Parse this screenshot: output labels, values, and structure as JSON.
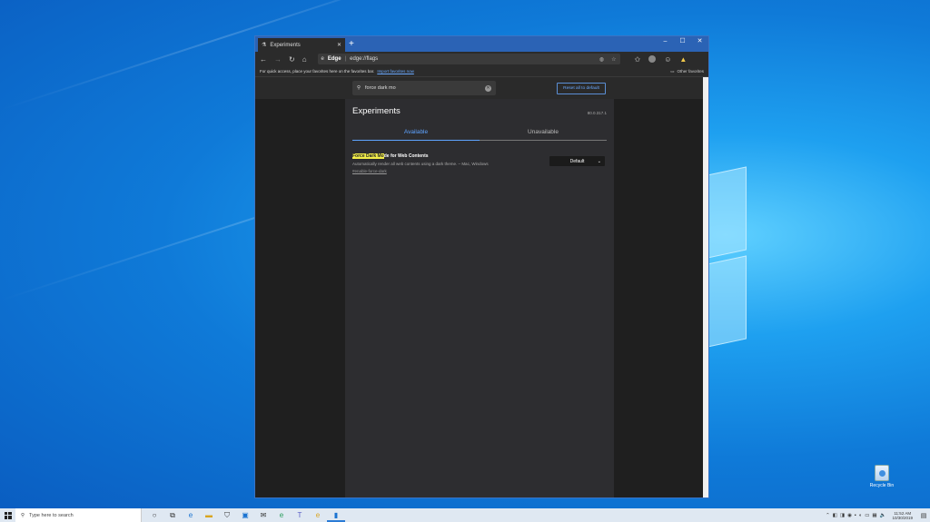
{
  "browser": {
    "tab_title": "Experiments",
    "new_tab": "+",
    "controls": {
      "minimize": "–",
      "maximize": "☐",
      "close": "✕"
    },
    "address": {
      "site": "Edge",
      "separator": "|",
      "url": "edge://flags"
    },
    "favorites_bar": {
      "message": "For quick access, place your favorites here on the favorites bar.",
      "import_link": "Import favorites now",
      "other_favorites": "Other favorites"
    }
  },
  "flags_page": {
    "search_value": "force dark mo",
    "reset_button": "Reset all to default",
    "title": "Experiments",
    "version": "80.0.317.1",
    "tabs": [
      {
        "label": "Available",
        "active": true
      },
      {
        "label": "Unavailable",
        "active": false
      }
    ],
    "flag": {
      "name_highlight": "Force Dark Mo",
      "name_rest": "de for Web Contents",
      "description": "Automatically render all web contents using a dark theme. – Mac, Windows",
      "link": "#enable-force-dark",
      "select_value": "Default"
    }
  },
  "desktop": {
    "recycle_bin_label": "Recycle Bin"
  },
  "taskbar": {
    "search_placeholder": "Type here to search",
    "time": "11:52 AM",
    "date": "10/30/2019"
  },
  "colors": {
    "accent": "#2b63b5",
    "link": "#5ea3ff",
    "highlight": "#f3ee4a"
  }
}
